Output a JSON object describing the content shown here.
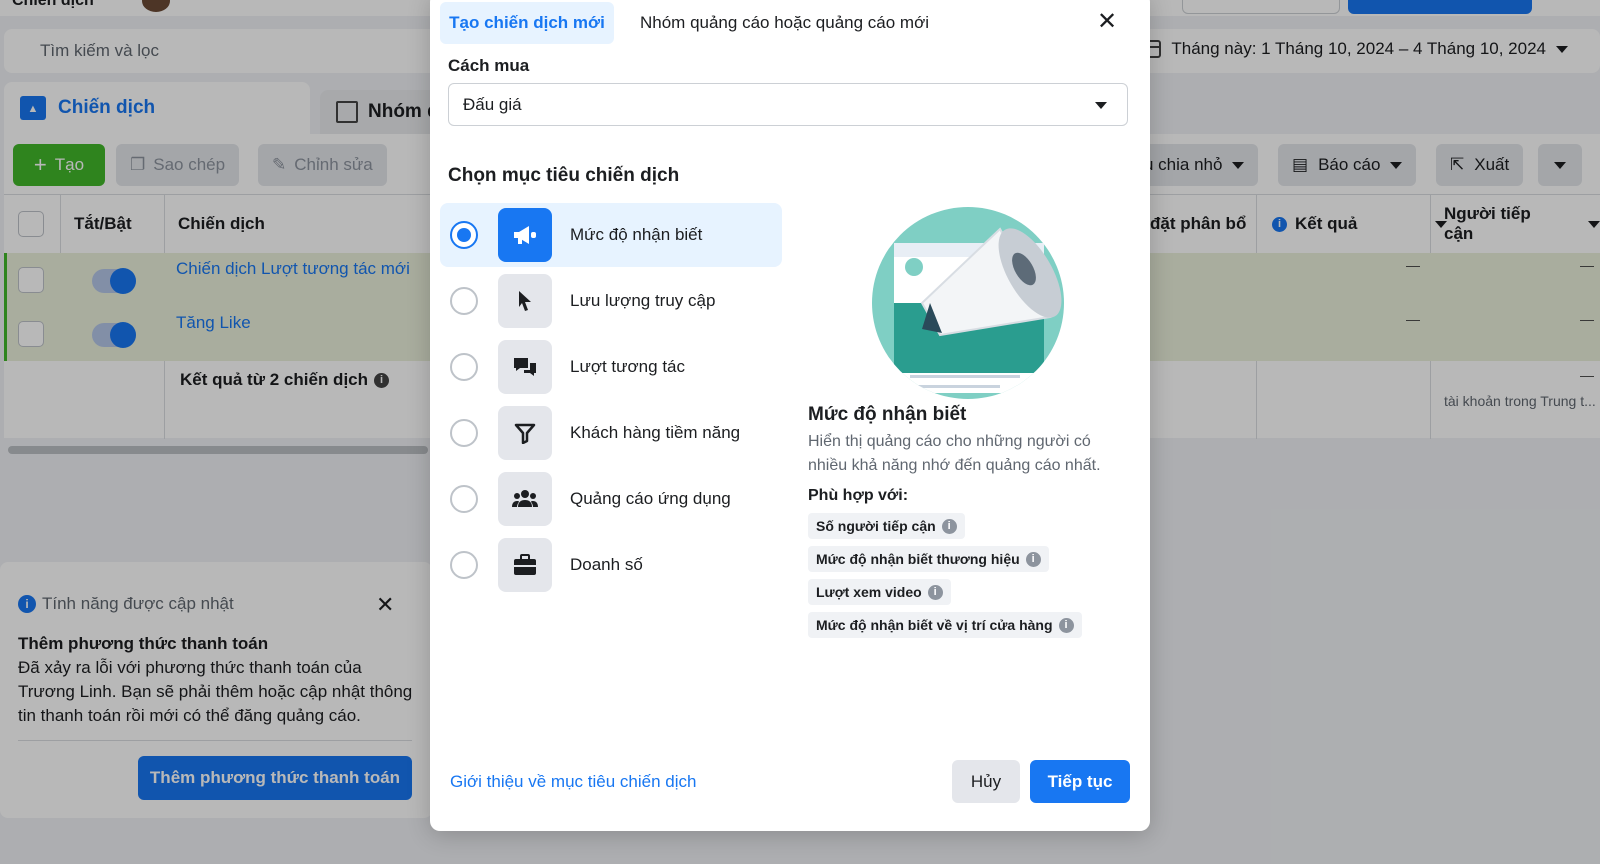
{
  "background": {
    "header_title": "Chiến dịch",
    "search_placeholder": "Tìm kiếm và lọc",
    "date_range": "Tháng này: 1 Tháng 10, 2024 – 4 Tháng 10, 2024",
    "tabs": {
      "campaigns": "Chiến dịch",
      "groups": "Nhóm q"
    },
    "toolbar": {
      "create": "Tạo",
      "copy": "Sao chép",
      "edit": "Chỉnh sửa",
      "breakdown": "u chia nhỏ",
      "report": "Báo cáo",
      "export": "Xuất"
    },
    "table": {
      "headers": {
        "toggle": "Tắt/Bật",
        "campaign": "Chiến dịch",
        "budget": "đặt phân bổ",
        "results": "Kết quả",
        "reach": "Người tiếp cận"
      },
      "rows": [
        {
          "name": "Chiến dịch Lượt tương tác mới",
          "results": "—",
          "reach": "—"
        },
        {
          "name": "Tăng Like",
          "results": "—",
          "reach": "—"
        }
      ],
      "summary": "Kết quả từ 2 chiến dịch",
      "summary_reach_dash": "—",
      "summary_reach_note": "tài khoản trong Trung t..."
    },
    "notice": {
      "header": "Tính năng được cập nhật",
      "title": "Thêm phương thức thanh toán",
      "body": "Đã xảy ra lỗi với phương thức thanh toán của Trương Linh. Bạn sẽ phải thêm hoặc cập nhật thông tin thanh toán rồi mới có thể đăng quảng cáo.",
      "button": "Thêm phương thức thanh toán"
    }
  },
  "modal": {
    "tab_active": "Tạo chiến dịch mới",
    "tab_other": "Nhóm quảng cáo hoặc quảng cáo mới",
    "buying_label": "Cách mua",
    "buying_value": "Đấu giá",
    "objective_heading": "Chọn mục tiêu chiến dịch",
    "objectives": [
      {
        "label": "Mức độ nhận biết",
        "icon": "megaphone-icon",
        "selected": true
      },
      {
        "label": "Lưu lượng truy cập",
        "icon": "cursor-icon",
        "selected": false
      },
      {
        "label": "Lượt tương tác",
        "icon": "chat-icon",
        "selected": false
      },
      {
        "label": "Khách hàng tiềm năng",
        "icon": "funnel-icon",
        "selected": false
      },
      {
        "label": "Quảng cáo ứng dụng",
        "icon": "people-icon",
        "selected": false
      },
      {
        "label": "Doanh số",
        "icon": "briefcase-icon",
        "selected": false
      }
    ],
    "detail": {
      "title": "Mức độ nhận biết",
      "description": "Hiển thị quảng cáo cho những người có nhiều khả năng nhớ đến quảng cáo nhất.",
      "fit_label": "Phù hợp với:",
      "chips": [
        "Số người tiếp cận",
        "Mức độ nhận biết thương hiệu",
        "Lượt xem video",
        "Mức độ nhận biết về vị trí cửa hàng"
      ]
    },
    "learn_link": "Giới thiệu về mục tiêu chiến dịch",
    "cancel": "Hủy",
    "continue": "Tiếp tục"
  },
  "colors": {
    "accent": "#1877f2",
    "create_green": "#42b72a"
  }
}
